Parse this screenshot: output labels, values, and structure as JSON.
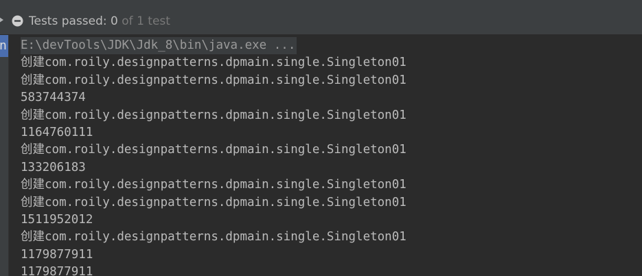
{
  "toolbar": {
    "status_icon": "minus-circle-icon",
    "status_label": "Tests passed: ",
    "passed_count": "0",
    "total_text": " of 1 test"
  },
  "sidebar": {
    "active_letter": "n"
  },
  "console": {
    "command": "E:\\devTools\\JDK\\Jdk_8\\bin\\java.exe ...",
    "lines": [
      "创建com.roily.designpatterns.dpmain.single.Singleton01",
      "创建com.roily.designpatterns.dpmain.single.Singleton01",
      "583744374",
      "创建com.roily.designpatterns.dpmain.single.Singleton01",
      "1164760111",
      "创建com.roily.designpatterns.dpmain.single.Singleton01",
      "133206183",
      "创建com.roily.designpatterns.dpmain.single.Singleton01",
      "创建com.roily.designpatterns.dpmain.single.Singleton01",
      "1511952012",
      "创建com.roily.designpatterns.dpmain.single.Singleton01",
      "1179877911",
      "1179877911"
    ]
  }
}
